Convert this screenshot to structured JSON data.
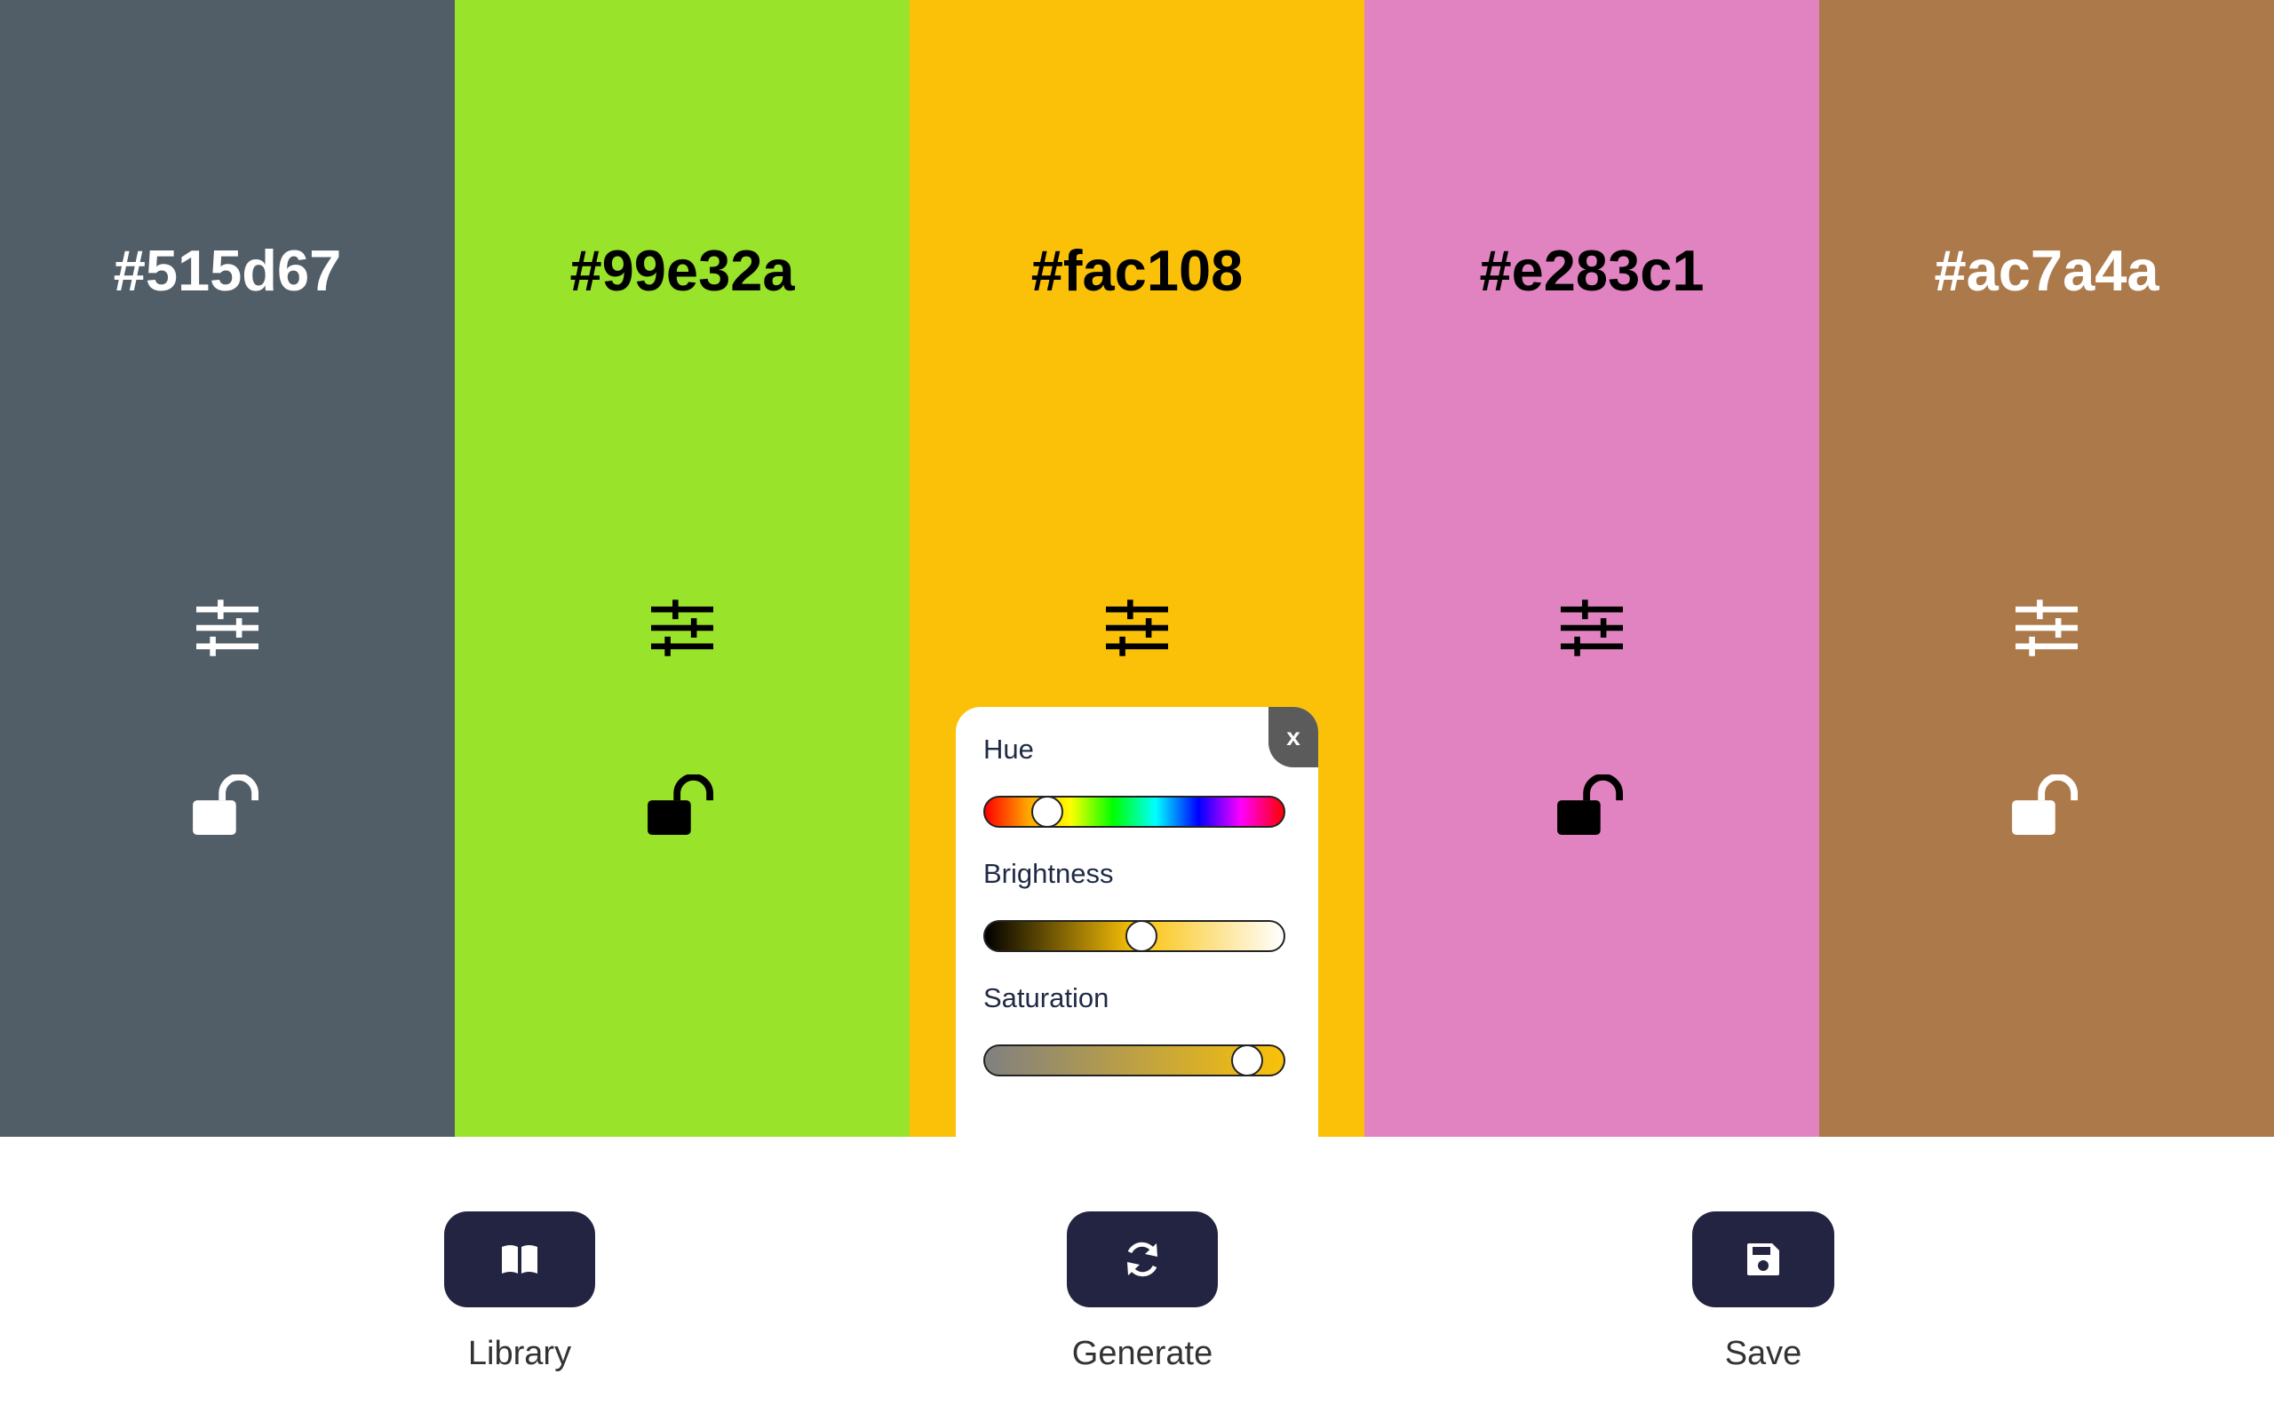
{
  "palette": {
    "swatches": [
      {
        "hex": "#515d67",
        "text_color": "#ffffff",
        "locked": false
      },
      {
        "hex": "#99e32a",
        "text_color": "#000000",
        "locked": false
      },
      {
        "hex": "#fac108",
        "text_color": "#000000",
        "locked": false
      },
      {
        "hex": "#e283c1",
        "text_color": "#000000",
        "locked": false
      },
      {
        "hex": "#ac7a4a",
        "text_color": "#ffffff",
        "locked": false
      }
    ]
  },
  "adjust_panel": {
    "close_label": "x",
    "hue": {
      "label": "Hue",
      "value_percent": 17
    },
    "brightness": {
      "label": "Brightness",
      "value_percent": 52
    },
    "saturation": {
      "label": "Saturation",
      "value_percent": 91
    }
  },
  "actions": {
    "library": {
      "label": "Library",
      "icon": "book-open-icon"
    },
    "generate": {
      "label": "Generate",
      "icon": "refresh-icon"
    },
    "save": {
      "label": "Save",
      "icon": "floppy-disk-icon"
    }
  },
  "colors": {
    "button_bg": "#232441",
    "close_bg": "#5b5b5b"
  }
}
